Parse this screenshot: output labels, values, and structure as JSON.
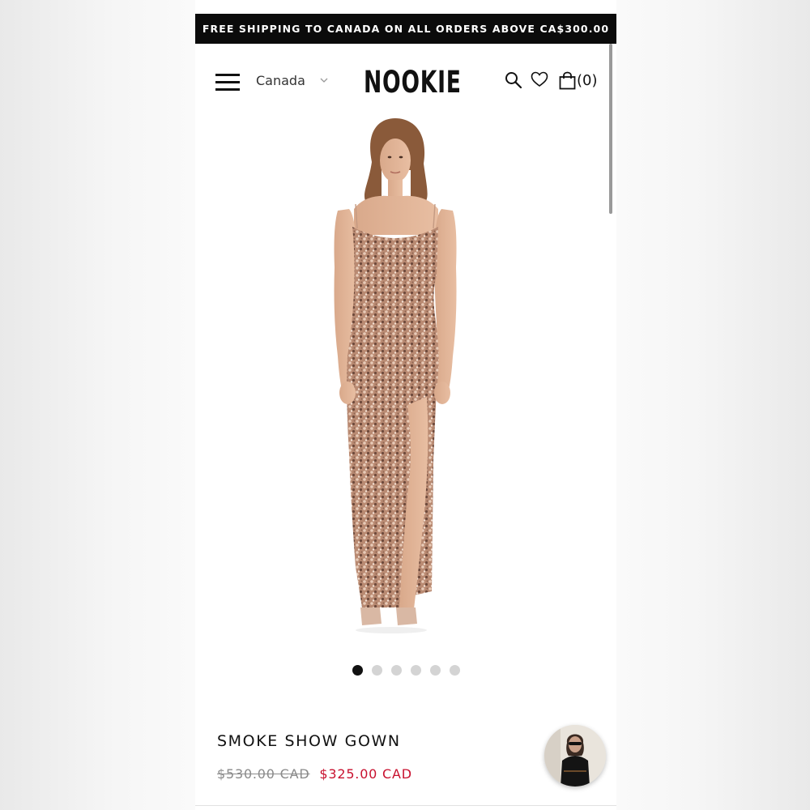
{
  "promo_bar": {
    "text": "FREE SHIPPING TO CANADA ON ALL ORDERS ABOVE CA$300.00"
  },
  "header": {
    "country": "Canada",
    "logo": "NOOKIE",
    "cart_count": "(0)",
    "icons": [
      "menu-icon",
      "chevron-down-icon",
      "search-icon",
      "heart-icon",
      "bag-icon"
    ]
  },
  "gallery": {
    "image": "sequin-gown-model",
    "dress_color": "#b98a72",
    "slide_count": 6,
    "active_slide": 1
  },
  "product": {
    "title": "SMOKE SHOW GOWN",
    "original_price": "$530.00 CAD",
    "sale_price": "$325.00 CAD",
    "sale_color": "#c8102e"
  },
  "chat": {
    "avatar": "chat-avatar-photo"
  }
}
